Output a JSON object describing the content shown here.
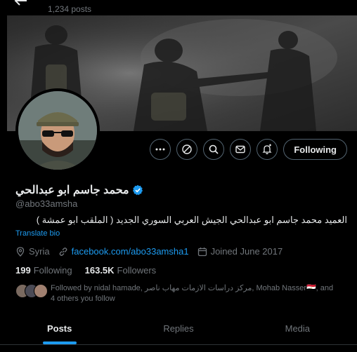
{
  "header": {
    "post_count": "1,234 posts"
  },
  "profile": {
    "display_name": "محمد جاسم ابو عبدالحي",
    "handle": "@abo33amsha",
    "verified": true,
    "bio": "العميد محمد جاسم ابو عبدالحي الجيش العربي السوري الجديد ( الملقب ابو عمشة )",
    "translate_label": "Translate bio",
    "location": "Syria",
    "website": "facebook.com/abo33amsha1",
    "joined": "Joined June 2017"
  },
  "actions": {
    "follow_label": "Following",
    "icons": [
      "more-icon",
      "grok-icon",
      "search-icon",
      "message-icon",
      "notify-icon"
    ]
  },
  "counts": {
    "following_num": "199",
    "following_label": "Following",
    "followers_num": "163.5K",
    "followers_label": "Followers"
  },
  "followers_you_know": {
    "text": "Followed by nidal hamade, مركز دراسات الازمات مهاب ناصر, ‎Mohab Nasser🇪🇬, and 4 others you follow"
  },
  "tabs": [
    {
      "label": "Posts",
      "active": true
    },
    {
      "label": "Replies",
      "active": false
    },
    {
      "label": "Media",
      "active": false
    }
  ],
  "colors": {
    "accent": "#1d9bf0",
    "background": "#000000",
    "muted": "#71767b"
  }
}
